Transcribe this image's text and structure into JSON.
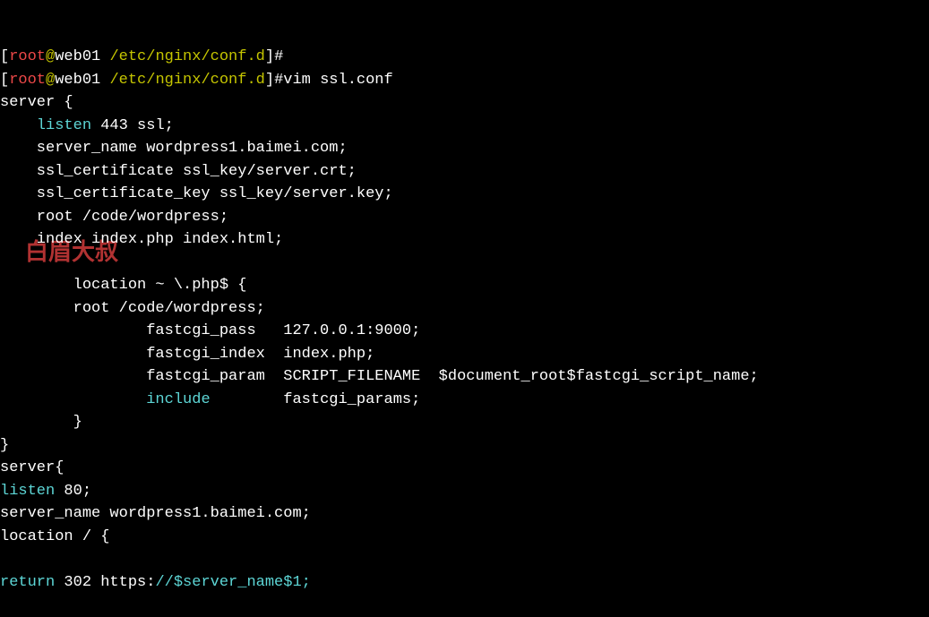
{
  "prompt1": {
    "open": "[",
    "user": "root",
    "at": "@",
    "host": "web01",
    "space": " ",
    "path": "/etc/nginx/conf.d",
    "close": "]",
    "hash": "#"
  },
  "prompt2": {
    "open": "[",
    "user": "root",
    "at": "@",
    "host": "web01",
    "space": " ",
    "path": "/etc/nginx/conf.d",
    "close": "]",
    "hash": "#",
    "cmd": "vim ssl.conf"
  },
  "config": {
    "line1": "server {",
    "line2_indent": "    ",
    "line2_kw": "listen",
    "line2_rest": " 443 ssl;",
    "line3": "    server_name wordpress1.baimei.com;",
    "line4": "    ssl_certificate ssl_key/server.crt;",
    "line5": "    ssl_certificate_key ssl_key/server.key;",
    "line6": "    root /code/wordpress;",
    "line7": "    index index.php index.html;",
    "line8": "",
    "line9": "        location ~ \\.php$ {",
    "line10": "        root /code/wordpress;",
    "line11": "                fastcgi_pass   127.0.0.1:9000;",
    "line12": "                fastcgi_index  index.php;",
    "line13": "                fastcgi_param  SCRIPT_FILENAME  $document_root$fastcgi_script_name;",
    "line14_indent": "                ",
    "line14_kw": "include",
    "line14_rest": "        fastcgi_params;",
    "line15": "        }",
    "line16": "}",
    "line17": "server{",
    "line18_kw": "listen",
    "line18_rest": " 80;",
    "line19": "server_name wordpress1.baimei.com;",
    "line20": "location / {",
    "line21": "",
    "line22_a": "return",
    "line22_b": " 302 https:",
    "line22_c": "//$server_name$1;"
  },
  "watermark": "白眉大叔"
}
